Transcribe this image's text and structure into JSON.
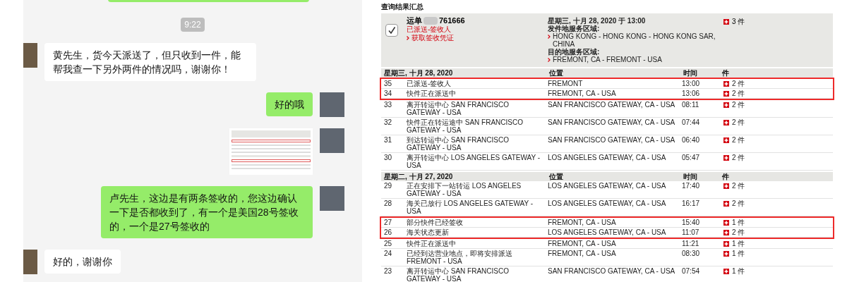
{
  "chat": {
    "time": "9:22",
    "messages": [
      {
        "kind": "cut",
        "outgoing": true
      },
      {
        "kind": "text",
        "outgoing": false,
        "text": "黄先生，货今天派送了，但只收到一件，能帮我查一下另外两件的情况吗，谢谢你！"
      },
      {
        "kind": "text",
        "outgoing": true,
        "text": "好的哦"
      },
      {
        "kind": "image",
        "outgoing": true
      },
      {
        "kind": "text",
        "outgoing": true,
        "text": "卢先生，这边是有两条签收的，您这边确认一下是否都收到了，有一个是美国28号签收的，一个是27号签收的"
      },
      {
        "kind": "text",
        "outgoing": false,
        "text": "好的，谢谢你"
      }
    ]
  },
  "tracking": {
    "title": "查询结果汇总",
    "summary": {
      "checked": true,
      "waybill_label": "运单",
      "waybill_number": "761666",
      "status": "已派送-签收人",
      "link": "获取签收凭证",
      "date_line": "星期三, 十月 28, 2020 于 13:00",
      "origin_label": "发件地服务区域:",
      "origin": "HONG KONG - HONG KONG - HONG KONG SAR, CHINA",
      "dest_label": "目的地服务区域:",
      "dest": "FREMONT, CA - FREMONT - USA",
      "pieces": "3 件"
    },
    "groups": [
      {
        "date": "星期三, 十月 28, 2020",
        "columns": [
          "位置",
          "时间",
          "件"
        ],
        "rows": [
          {
            "no": "35",
            "event": "已派送-签收人",
            "location": "FREMONT",
            "time": "13:00",
            "pieces": "2 件",
            "highlighted": true
          },
          {
            "no": "34",
            "event": "快件正在派送中",
            "location": "FREMONT, CA - USA",
            "time": "13:06",
            "pieces": "2 件",
            "highlighted": true
          },
          {
            "no": "33",
            "event": "离开转运中心 SAN FRANCISCO GATEWAY - USA",
            "location": "SAN FRANCISCO GATEWAY, CA - USA",
            "time": "08:11",
            "pieces": "2 件",
            "highlighted": false
          },
          {
            "no": "32",
            "event": "快件正在转运途中 SAN FRANCISCO GATEWAY - USA",
            "location": "SAN FRANCISCO GATEWAY, CA - USA",
            "time": "07:44",
            "pieces": "2 件",
            "highlighted": false
          },
          {
            "no": "31",
            "event": "到达转运中心 SAN FRANCISCO GATEWAY - USA",
            "location": "SAN FRANCISCO GATEWAY, CA - USA",
            "time": "06:40",
            "pieces": "2 件",
            "highlighted": false
          },
          {
            "no": "30",
            "event": "离开转运中心 LOS ANGELES GATEWAY - USA",
            "location": "LOS ANGELES GATEWAY, CA - USA",
            "time": "05:47",
            "pieces": "2 件",
            "highlighted": false
          }
        ]
      },
      {
        "date": "星期二, 十月 27, 2020",
        "columns": [
          "位置",
          "时间",
          "件"
        ],
        "rows": [
          {
            "no": "29",
            "event": "正在安排下一站转运 LOS ANGELES GATEWAY - USA",
            "location": "LOS ANGELES GATEWAY, CA - USA",
            "time": "17:40",
            "pieces": "2 件",
            "highlighted": false
          },
          {
            "no": "28",
            "event": "海关已放行 LOS ANGELES GATEWAY - USA",
            "location": "LOS ANGELES GATEWAY, CA - USA",
            "time": "16:17",
            "pieces": "2 件",
            "highlighted": false
          },
          {
            "no": "27",
            "event": "部分快件已经签收",
            "location": "FREMONT, CA - USA",
            "time": "15:40",
            "pieces": "1 件",
            "highlighted": true
          },
          {
            "no": "26",
            "event": "海关状态更新",
            "location": "LOS ANGELES GATEWAY, CA - USA",
            "time": "11:07",
            "pieces": "2 件",
            "highlighted": true
          },
          {
            "no": "25",
            "event": "快件正在派送中",
            "location": "FREMONT, CA - USA",
            "time": "11:21",
            "pieces": "1 件",
            "highlighted": false
          },
          {
            "no": "24",
            "event": "已经到达营业地点，即将安排派送 FREMONT - USA",
            "location": "FREMONT, CA - USA",
            "time": "08:30",
            "pieces": "1 件",
            "highlighted": false
          },
          {
            "no": "23",
            "event": "离开转运中心 SAN FRANCISCO GATEWAY - USA",
            "location": "SAN FRANCISCO GATEWAY, CA - USA",
            "time": "07:54",
            "pieces": "1 件",
            "highlighted": false
          }
        ]
      }
    ]
  }
}
